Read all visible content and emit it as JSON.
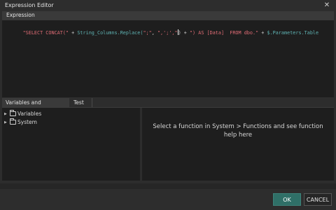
{
  "window": {
    "title": "Expression Editor",
    "close_glyph": "✕"
  },
  "expression_section": {
    "header": "Expression"
  },
  "editor": {
    "tokens": [
      {
        "text": "\"SELECT CONCAT(\"",
        "kind": "string"
      },
      {
        "text": " + ",
        "kind": "plain"
      },
      {
        "text": "String_Columns.Replace(",
        "kind": "identifier"
      },
      {
        "text": "\";\"",
        "kind": "string"
      },
      {
        "text": ", ",
        "kind": "plain"
      },
      {
        "text": "\",';',\"",
        "kind": "string"
      },
      {
        "text": ") + ",
        "kind": "plain"
      },
      {
        "text": "\") AS [Data]  FROM dbo.\"",
        "kind": "string"
      },
      {
        "text": " + ",
        "kind": "plain"
      },
      {
        "text": "$.Parameters.Table",
        "kind": "identifier"
      }
    ]
  },
  "tabs": [
    {
      "label": "Variables and functions",
      "active": true
    },
    {
      "label": "Test",
      "active": false
    }
  ],
  "tree": {
    "items": [
      {
        "label": "Variables",
        "icon": "folder-icon"
      },
      {
        "label": "System",
        "icon": "folder-icon"
      }
    ],
    "expand_glyph": "▶"
  },
  "help": {
    "text": "Select a function in System > Functions and see function help here"
  },
  "buttons": {
    "ok_label": "OK",
    "cancel_label": "CANCEL"
  },
  "colors": {
    "accent": "#2f6f67",
    "string": "#e06c75",
    "identifier": "#5fb3b3"
  }
}
